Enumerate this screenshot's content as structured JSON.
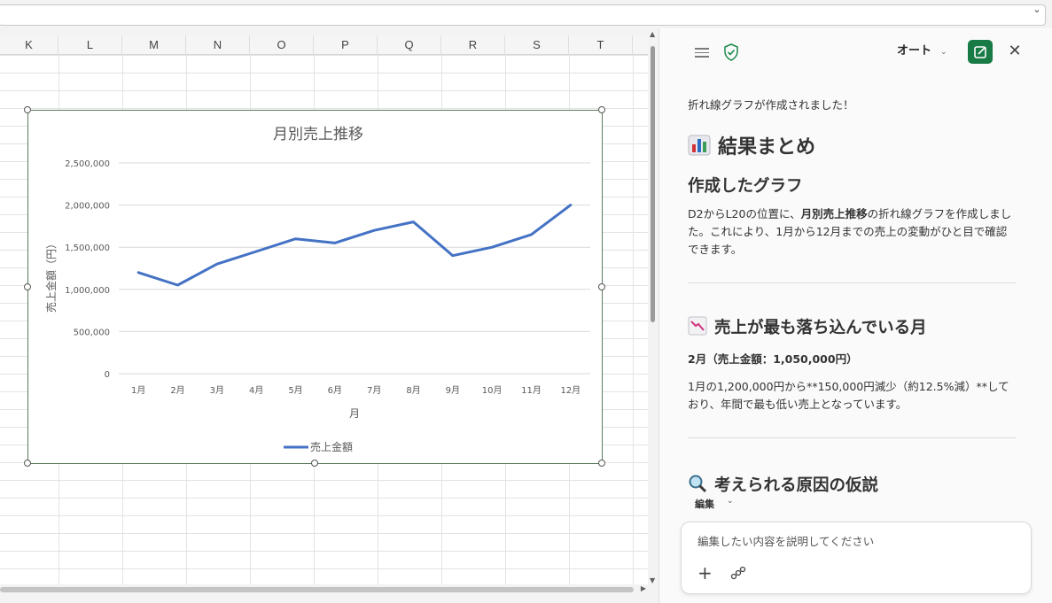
{
  "columns": [
    "K",
    "L",
    "M",
    "N",
    "O",
    "P",
    "Q",
    "R",
    "S",
    "T"
  ],
  "chart_data": {
    "type": "line",
    "title": "月別売上推移",
    "xlabel": "月",
    "ylabel": "売上金額（円）",
    "categories": [
      "1月",
      "2月",
      "3月",
      "4月",
      "5月",
      "6月",
      "7月",
      "8月",
      "9月",
      "10月",
      "11月",
      "12月"
    ],
    "series": [
      {
        "name": "売上金額",
        "values": [
          1200000,
          1050000,
          1300000,
          1450000,
          1600000,
          1550000,
          1700000,
          1800000,
          1400000,
          1500000,
          1650000,
          2000000
        ],
        "color": "#4472c4"
      }
    ],
    "ylim": [
      0,
      2500000
    ],
    "yticks": [
      0,
      500000,
      1000000,
      1500000,
      2000000,
      2500000
    ],
    "ytick_labels": [
      "0",
      "500,000",
      "1,000,000",
      "1,500,000",
      "2,000,000",
      "2,500,000"
    ],
    "legend_position": "bottom",
    "grid": true
  },
  "pane": {
    "mode_label": "オート",
    "intro": "折れ線グラフが作成されました！",
    "heading": "結果まとめ",
    "section1_title": "作成したグラフ",
    "section1_p1": "D2からL20の位置に、",
    "section1_bold": "月別売上推移",
    "section1_p2": "の折れ線グラフを作成しました。これにより、1月から12月までの売上の変動がひと目で確認できます。",
    "section2_title": "売上が最も落ち込んでいる月",
    "section2_bold": "2月（売上金額：1,050,000円）",
    "section2_text": "1月の1,200,000円から**150,000円減少（約12.5%減）**しており、年間で最も低い売上となっています。",
    "section3_title": "考えられる原因の仮説",
    "edit_label": "編集",
    "composer_placeholder": "編集したい内容を説明してください"
  }
}
